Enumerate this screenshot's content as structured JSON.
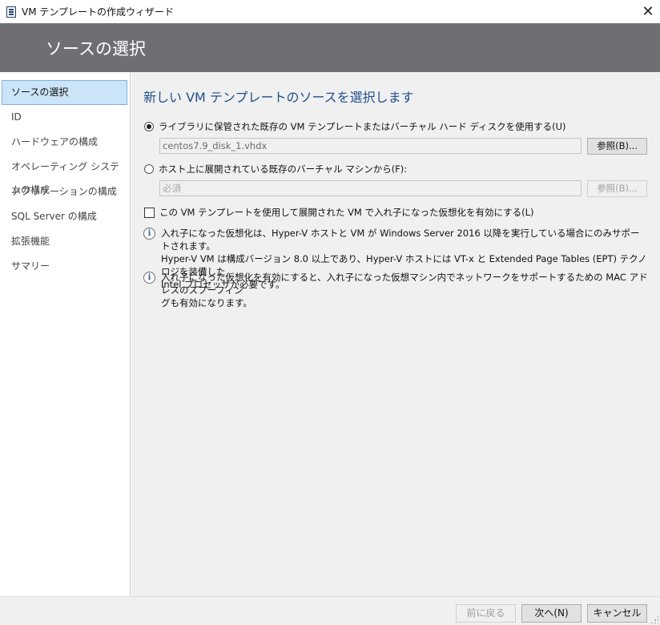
{
  "window": {
    "title": "VM テンプレートの作成ウィザード",
    "app_icon": "document-icon",
    "close_glyph": "✕"
  },
  "banner": {
    "heading": "ソースの選択"
  },
  "sidebar": {
    "items": [
      {
        "label": "ソースの選択",
        "active": true
      },
      {
        "label": "ID",
        "active": false
      },
      {
        "label": "ハードウェアの構成",
        "active": false
      },
      {
        "label": "オペレーティング システムの構成",
        "active": false
      },
      {
        "label": "アプリケーションの構成",
        "active": false
      },
      {
        "label": "SQL Server の構成",
        "active": false
      },
      {
        "label": "拡張機能",
        "active": false
      },
      {
        "label": "サマリー",
        "active": false
      }
    ]
  },
  "main": {
    "title": "新しい VM テンプレートのソースを選択します",
    "option_library": {
      "label": "ライブラリに保管された既存の VM テンプレートまたはバーチャル ハード ディスクを使用する(U)",
      "selected": true,
      "value": "centos7.9_disk_1.vhdx",
      "browse_label": "参照(B)..."
    },
    "option_host": {
      "label": "ホスト上に展開されている既存のバーチャル マシンから(F):",
      "selected": false,
      "placeholder": "必須",
      "browse_label": "参照(B)..."
    },
    "nested_virtualization": {
      "label": "この VM テンプレートを使用して展開された VM で入れ子になった仮想化を有効にする(L)",
      "checked": false
    },
    "info_1": {
      "lines": [
        "入れ子になった仮想化は、Hyper-V ホストと VM が Windows Server 2016 以降を実行している場合にのみサポートされます。",
        "Hyper-V VM は構成バージョン 8.0 以上であり、Hyper-V ホストには VT-x と Extended Page Tables (EPT) テクノロジを装備した",
        "Intel プロセッサが必要です。"
      ]
    },
    "info_2": {
      "lines": [
        "入れ子になった仮想化を有効にすると、入れ子になった仮想マシン内でネットワークをサポートするための MAC アドレスのスプーフィン",
        "グも有効になります。"
      ]
    }
  },
  "footer": {
    "back_label": "前に戻る",
    "next_label": "次へ(N)",
    "cancel_label": "キャンセル"
  },
  "colors": {
    "banner_bg": "#6e6f73",
    "accent_title": "#1f4e8c",
    "nav_active_bg": "#cce4f7",
    "content_bg": "#f0f0f0"
  }
}
